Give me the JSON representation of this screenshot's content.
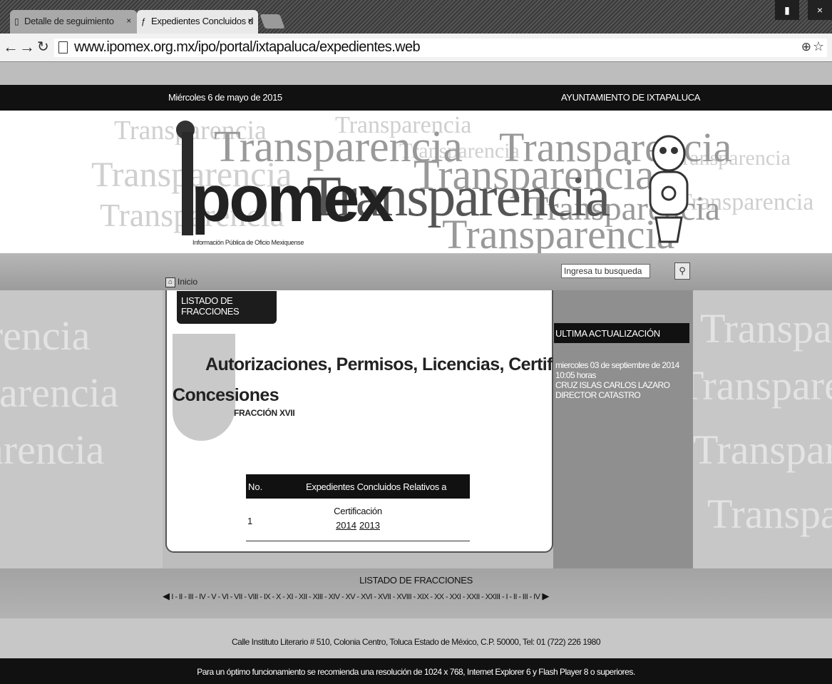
{
  "browser": {
    "tabs": [
      {
        "label": "Detalle de seguimiento",
        "active": false
      },
      {
        "label": "Expedientes Concluidos d",
        "active": true
      }
    ],
    "url": "www.ipomex.org.mx/ipo/portal/ixtapaluca/expedientes.web"
  },
  "header": {
    "date": "Miércoles 6 de mayo de 2015",
    "entity": "AYUNTAMIENTO DE IXTAPALUCA"
  },
  "banner": {
    "logo_text": "pomex",
    "logo_subtitle": "Información Pública de Oficio Mexiquense",
    "watermark_word": "Transparencia"
  },
  "nav": {
    "home_label": "Inicio",
    "search_placeholder": "Ingresa tu busqueda"
  },
  "main": {
    "tab_label": "LISTADO DE FRACCIONES",
    "title_line1": "Autorizaciones, Permisos, Licencias, Certificaciones y",
    "title_line2": "Concesiones",
    "fraction": "FRACCIÓN XVII",
    "table": {
      "col_no": "No.",
      "col_title": "Expedientes Concluidos Relativos a",
      "rows": [
        {
          "no": "1",
          "name": "Certificación",
          "years": [
            "2014",
            "2013"
          ]
        }
      ]
    }
  },
  "update": {
    "heading": "ULTIMA ACTUALIZACIÓN",
    "date": "miercoles 03 de septiembre de 2014",
    "time": "10:05 horas",
    "person": "CRUZ ISLAS CARLOS LAZARO",
    "role": "DIRECTOR CATASTRO"
  },
  "fractions_bar": {
    "title": "LISTADO DE FRACCIONES",
    "items": "I - II - III - IV - V - VI - VII - VIII - IX - X - XI - XII - XIII - XIV - XV - XVI - XVII - XVIII - XIX - XX - XXI - XXII - XXIII - I - II - III - IV"
  },
  "footer": {
    "address": "Calle Instituto Literario # 510, Colonia Centro, Toluca Estado de México, C.P. 50000, Tel: 01 (722) 226 1980",
    "note": "Para un óptimo funcionamiento se recomienda una resolución de 1024 x 768, Internet Explorer 6 y Flash Player 8 o superiores."
  }
}
